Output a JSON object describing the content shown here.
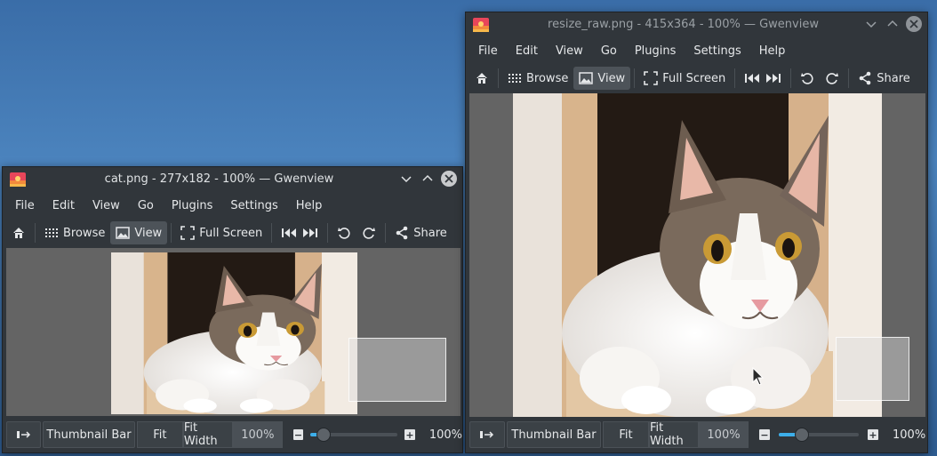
{
  "menu": [
    "File",
    "Edit",
    "View",
    "Go",
    "Plugins",
    "Settings",
    "Help"
  ],
  "toolbar": {
    "browse": "Browse",
    "view": "View",
    "full_screen": "Full Screen",
    "share": "Share"
  },
  "statusbar": {
    "thumbnail_bar": "Thumbnail Bar",
    "fit": "Fit",
    "fit_width": "Fit Width",
    "zoom_value": "100%",
    "zoom_label": "100%"
  },
  "windows": {
    "left": {
      "title": "cat.png - 277x182 - 100% — Gwenview",
      "zoom_slider_level": 0.15
    },
    "right": {
      "title": "resize_raw.png - 415x364 - 100% — Gwenview",
      "zoom_slider_level": 0.3
    }
  },
  "colors": {
    "accent": "#3daee9",
    "window_bg": "#31363b",
    "viewport_bg": "#646464",
    "desktop": "#3a6da8"
  },
  "icons": [
    "gwenview-icon",
    "chevron-down-icon",
    "chevron-up-icon",
    "close-icon",
    "home-icon",
    "grid-icon",
    "image-icon",
    "fullscreen-icon",
    "skip-previous-icon",
    "skip-next-icon",
    "rotate-left-icon",
    "rotate-right-icon",
    "share-icon",
    "sidebar-toggle-icon",
    "zoom-out-icon",
    "zoom-in-icon",
    "mouse-pointer-icon"
  ]
}
